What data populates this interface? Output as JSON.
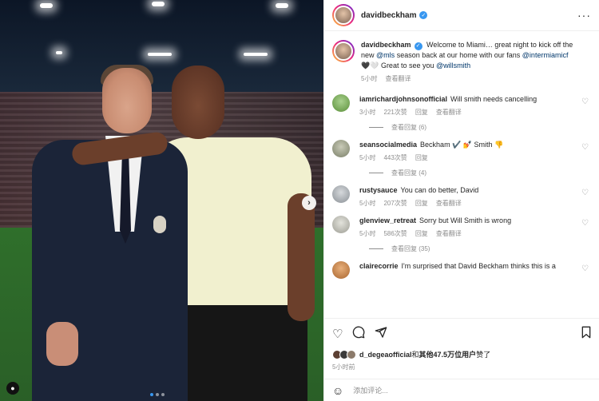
{
  "post_owner": {
    "username": "davidbeckham",
    "verified_icon": "verified-check-icon"
  },
  "caption": {
    "username": "davidbeckham",
    "text_1": "Welcome to Miami… great night to kick off the new",
    "mention_mls": "@mls",
    "text_2": "season back at our home with our fans",
    "mention_intermiami": "@intermiamicf",
    "emoji": "🖤🤍",
    "text_3": "Great to see you",
    "mention_willsmith": "@willsmith",
    "time": "5小时",
    "translate": "查看翻译"
  },
  "comments": [
    {
      "username": "iamrichardjohnsonofficial",
      "text": "Will smith needs cancelling",
      "time": "3小时",
      "likes": "221次赞",
      "reply": "回复",
      "translate": "查看翻译",
      "view_replies": "查看回复 (6)",
      "avatar_color": "#6aa84f"
    },
    {
      "username": "seansocialmedia",
      "text": "Beckham ✔️ 💅 Smith 👎",
      "time": "5小时",
      "likes": "443次赞",
      "reply": "回复",
      "translate": "",
      "view_replies": "查看回复 (4)",
      "avatar_color": "#8a8f7a"
    },
    {
      "username": "rustysauce",
      "text": "You can do better, David",
      "time": "5小时",
      "likes": "207次赞",
      "reply": "回复",
      "translate": "查看翻译",
      "view_replies": "",
      "avatar_color": "#9aa0a6"
    },
    {
      "username": "glenview_retreat",
      "text": "Sorry but Will Smith is wrong",
      "time": "5小时",
      "likes": "586次赞",
      "reply": "回复",
      "translate": "查看翻译",
      "view_replies": "查看回复 (35)",
      "avatar_color": "#b8b8b0"
    },
    {
      "username": "clairecorrie",
      "text": "I'm surprised that David Beckham thinks this is a",
      "time": "",
      "likes": "",
      "reply": "",
      "translate": "",
      "view_replies": "",
      "avatar_color": "#c47a3a"
    }
  ],
  "likes_summary": {
    "user": "d_degeaofficial",
    "connector": "和",
    "others": "其他47.5万位用户",
    "suffix": "赞了"
  },
  "post_time": "5小时前",
  "add_comment": {
    "placeholder": "添加评论..."
  },
  "icons": {
    "more": "more-options-icon",
    "like": "heart-icon",
    "comment": "comment-icon",
    "share": "share-icon",
    "save": "bookmark-icon",
    "next": "chevron-right-icon",
    "emoji": "emoji-icon",
    "user_tag": "user-tag-icon"
  },
  "carousel": {
    "total": 3,
    "active": 1
  }
}
